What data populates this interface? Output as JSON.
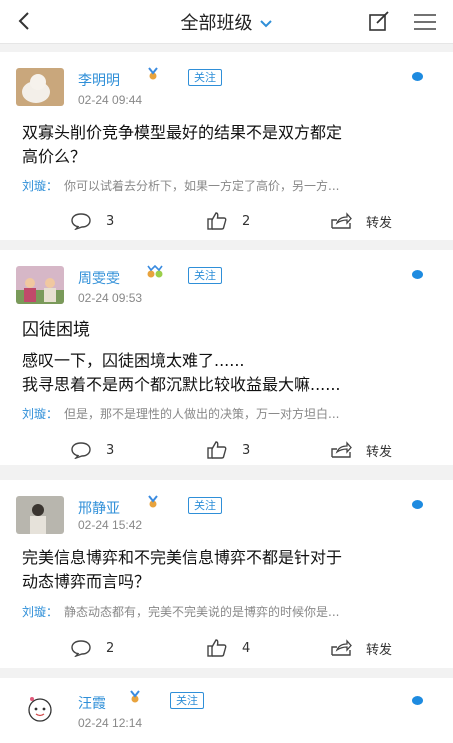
{
  "header": {
    "title": "全部班级"
  },
  "posts": [
    {
      "author": "李明明",
      "follow": "关注",
      "time": "02-24 09:44",
      "question_lines": [
        "双寡头削价竞争模型最好的结果不是双方都定",
        "高价么？"
      ],
      "reply_author": "刘璇：",
      "reply_text": "你可以试着去分析下，如果一方定了高价，另一方...",
      "comments": "3",
      "likes": "2",
      "forward": "转发"
    },
    {
      "author": "周雯雯",
      "follow": "关注",
      "time": "02-24 09:53",
      "title": "囚徒困境",
      "question_lines": [
        "感叹一下，囚徒困境太难了......",
        "我寻思着不是两个都沉默比较收益最大嘛......"
      ],
      "reply_author": "刘璇：",
      "reply_text": "但是，那不是理性的人做出的决策，万一对方坦白...",
      "comments": "3",
      "likes": "3",
      "forward": "转发"
    },
    {
      "author": "邢静亚",
      "follow": "关注",
      "time": "02-24 15:42",
      "question_lines": [
        "完美信息博弈和不完美信息博弈不都是针对于",
        "动态博弈而言吗？"
      ],
      "reply_author": "刘璇：",
      "reply_text": "静态动态都有，完美不完美说的是博弈的时候你是...",
      "comments": "2",
      "likes": "4",
      "forward": "转发"
    },
    {
      "author": "汪霞",
      "follow": "关注",
      "time": "02-24 12:14"
    }
  ]
}
